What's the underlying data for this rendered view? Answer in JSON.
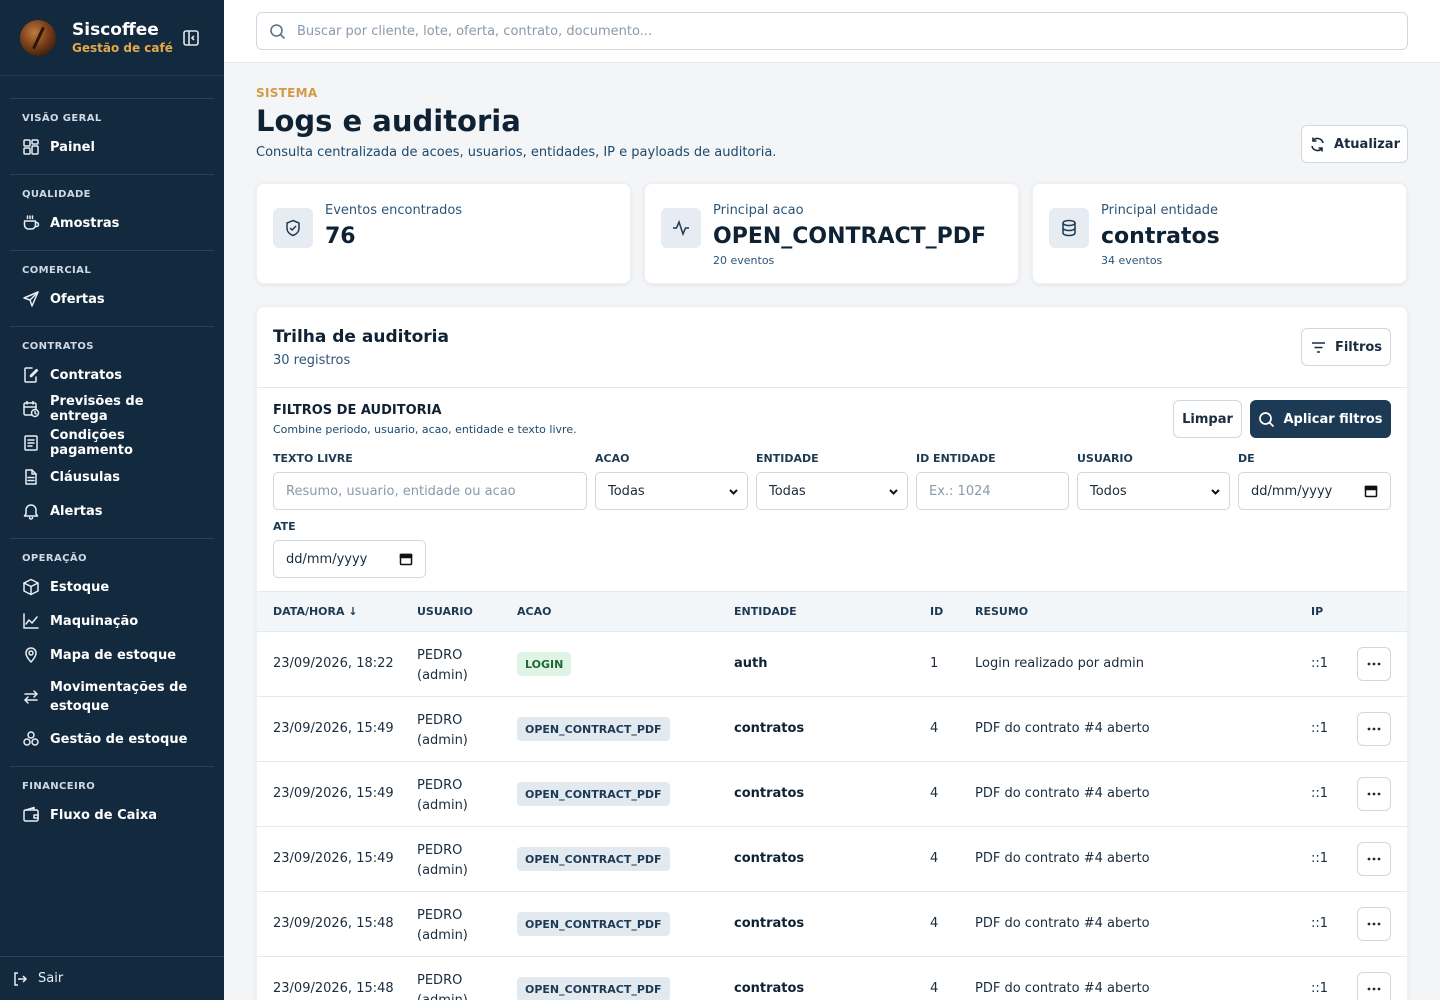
{
  "brand": {
    "name": "Siscoffee",
    "subtitle": "Gestão de café"
  },
  "sidebar": {
    "sections": [
      {
        "title": "VISÃO GERAL",
        "items": [
          {
            "label": "Painel",
            "icon": "dashboard-icon"
          }
        ]
      },
      {
        "title": "QUALIDADE",
        "items": [
          {
            "label": "Amostras",
            "icon": "coffee-cup-icon"
          }
        ]
      },
      {
        "title": "COMERCIAL",
        "items": [
          {
            "label": "Ofertas",
            "icon": "send-icon"
          }
        ]
      },
      {
        "title": "CONTRATOS",
        "items": [
          {
            "label": "Contratos",
            "icon": "edit-document-icon"
          },
          {
            "label": "Previsões de entrega",
            "icon": "calendar-clock-icon"
          },
          {
            "label": "Condições pagamento",
            "icon": "receipt-icon"
          },
          {
            "label": "Cláusulas",
            "icon": "document-icon"
          },
          {
            "label": "Alertas",
            "icon": "bell-icon"
          }
        ]
      },
      {
        "title": "OPERAÇÃO",
        "items": [
          {
            "label": "Estoque",
            "icon": "box-icon"
          },
          {
            "label": "Maquinação",
            "icon": "chart-icon"
          },
          {
            "label": "Mapa de estoque",
            "icon": "map-pin-icon"
          },
          {
            "label": "Movimentações de estoque",
            "icon": "arrows-swap-icon"
          },
          {
            "label": "Gestão de estoque",
            "icon": "boxes-icon"
          }
        ]
      },
      {
        "title": "FINANCEIRO",
        "items": [
          {
            "label": "Fluxo de Caixa",
            "icon": "wallet-icon"
          }
        ]
      }
    ],
    "logout": "Sair"
  },
  "search": {
    "placeholder": "Buscar por cliente, lote, oferta, contrato, documento..."
  },
  "header": {
    "eyebrow": "SISTEMA",
    "title": "Logs e auditoria",
    "subtitle": "Consulta centralizada de acoes, usuarios, entidades, IP e payloads de auditoria.",
    "refresh_label": "Atualizar"
  },
  "stats": [
    {
      "label": "Eventos encontrados",
      "value": "76",
      "note": "",
      "icon": "shield-check-icon"
    },
    {
      "label": "Principal acao",
      "value": "OPEN_CONTRACT_PDF",
      "note": "20 eventos",
      "icon": "activity-icon"
    },
    {
      "label": "Principal entidade",
      "value": "contratos",
      "note": "34 eventos",
      "icon": "database-icon"
    }
  ],
  "audit": {
    "title": "Trilha de auditoria",
    "count": "30 registros",
    "filters_button": "Filtros",
    "filters": {
      "title": "FILTROS DE AUDITORIA",
      "description": "Combine periodo, usuario, acao, entidade e texto livre.",
      "clear_label": "Limpar",
      "apply_label": "Aplicar filtros",
      "free_text": {
        "label": "TEXTO LIVRE",
        "placeholder": "Resumo, usuario, entidade ou acao"
      },
      "action": {
        "label": "ACAO",
        "value": "Todas"
      },
      "entity": {
        "label": "ENTIDADE",
        "value": "Todas"
      },
      "entity_id": {
        "label": "ID ENTIDADE",
        "placeholder": "Ex.: 1024"
      },
      "user": {
        "label": "USUARIO",
        "value": "Todos"
      },
      "from": {
        "label": "DE",
        "value": "dd/mm/yyyy"
      },
      "to": {
        "label": "ATE",
        "value": "dd/mm/yyyy"
      }
    },
    "columns": [
      "DATA/HORA ↓",
      "USUARIO",
      "ACAO",
      "ENTIDADE",
      "ID",
      "RESUMO",
      "IP"
    ],
    "rows": [
      {
        "datetime": "23/09/2026, 18:22",
        "user": "PEDRO",
        "role": "(admin)",
        "action": "LOGIN",
        "entity": "auth",
        "id": "1",
        "summary": "Login realizado por admin",
        "ip": "::1"
      },
      {
        "datetime": "23/09/2026, 15:49",
        "user": "PEDRO",
        "role": "(admin)",
        "action": "OPEN_CONTRACT_PDF",
        "entity": "contratos",
        "id": "4",
        "summary": "PDF do contrato #4 aberto",
        "ip": "::1"
      },
      {
        "datetime": "23/09/2026, 15:49",
        "user": "PEDRO",
        "role": "(admin)",
        "action": "OPEN_CONTRACT_PDF",
        "entity": "contratos",
        "id": "4",
        "summary": "PDF do contrato #4 aberto",
        "ip": "::1"
      },
      {
        "datetime": "23/09/2026, 15:49",
        "user": "PEDRO",
        "role": "(admin)",
        "action": "OPEN_CONTRACT_PDF",
        "entity": "contratos",
        "id": "4",
        "summary": "PDF do contrato #4 aberto",
        "ip": "::1"
      },
      {
        "datetime": "23/09/2026, 15:48",
        "user": "PEDRO",
        "role": "(admin)",
        "action": "OPEN_CONTRACT_PDF",
        "entity": "contratos",
        "id": "4",
        "summary": "PDF do contrato #4 aberto",
        "ip": "::1"
      },
      {
        "datetime": "23/09/2026, 15:48",
        "user": "PEDRO",
        "role": "(admin)",
        "action": "OPEN_CONTRACT_PDF",
        "entity": "contratos",
        "id": "4",
        "summary": "PDF do contrato #4 aberto",
        "ip": "::1"
      }
    ]
  },
  "colors": {
    "sidebar": "#13293d",
    "accent": "#d39a45",
    "primary_button": "#1c3a54",
    "login_badge": "#dff4e5"
  }
}
